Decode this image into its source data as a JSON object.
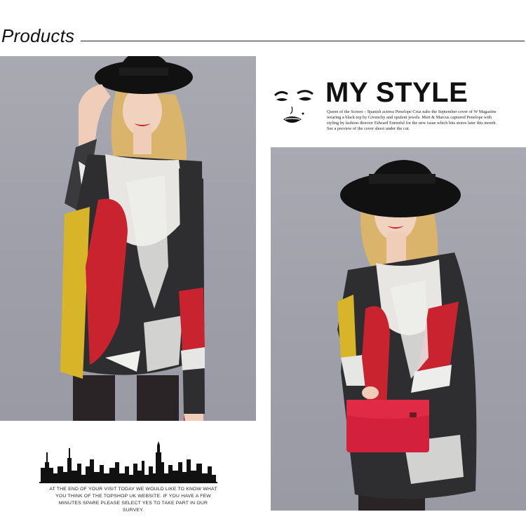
{
  "heading": {
    "title": "Products"
  },
  "mystyle": {
    "title": "MY STYLE",
    "text": "Queen of the Screen – Spanish actress Penelope Cruz nabs the September cover of W Magazine wearing a black top by Givenchy and opulent jewels. Mert & Marcus captured Penelope with styling by fashion director Edward Enninful for the new issue which hits stores later this month. See a preview of the cover shoot under the cut."
  },
  "survey": {
    "text": "AT THE END OF YOUR VISIT TODAY WE WOULD LIKE TO KNOW WHAT YOU THINK OF THE TOPSHOP UK WEBSITE. IF YOU HAVE A FEW MINUTES SPARE PLEASE SELECT YES TO TAKE PART IN OUR SURVEY."
  },
  "icons": [
    "lips-face-icon",
    "city-skyline-icon"
  ],
  "colors": {
    "background": "#ffffff",
    "photo_background": "#a4a4ae",
    "sweater_dark": "#2e2e30",
    "sweater_red": "#c8232f",
    "sweater_yellow": "#d8b428",
    "hat": "#111111"
  }
}
